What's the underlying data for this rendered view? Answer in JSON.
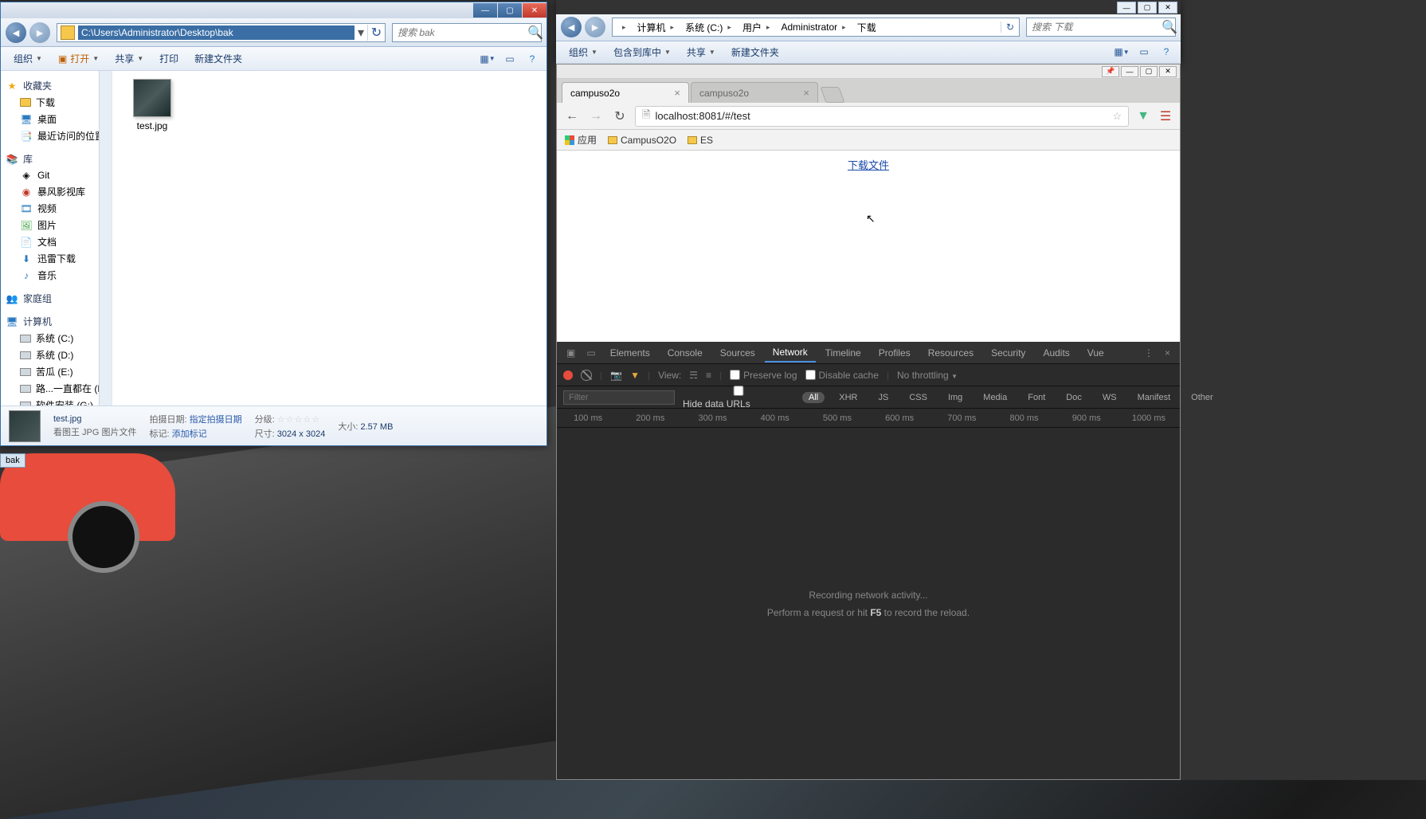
{
  "desktop": {
    "taskbar_item": "bak"
  },
  "explorer_left": {
    "titlebar": {
      "minimize": "—",
      "maximize": "▢",
      "close": "✕"
    },
    "address": "C:\\Users\\Administrator\\Desktop\\bak",
    "address_dropdown": "▾",
    "refresh": "↻",
    "search_placeholder": "搜索 bak",
    "toolbar": {
      "organize": "组织",
      "open": "打开",
      "share": "共享",
      "print": "打印",
      "new_folder": "新建文件夹"
    },
    "sidebar": {
      "favorites": {
        "label": "收藏夹",
        "items": [
          "下载",
          "桌面",
          "最近访问的位置"
        ]
      },
      "libraries": {
        "label": "库",
        "items": [
          "Git",
          "暴风影视库",
          "视频",
          "图片",
          "文档",
          "迅雷下载",
          "音乐"
        ]
      },
      "homegroup": {
        "label": "家庭组"
      },
      "computer": {
        "label": "计算机",
        "items": [
          "系统 (C:)",
          "系统 (D:)",
          "苦瓜 (E:)",
          "路...一直都在 (F:)",
          "软件安装 (G:)"
        ]
      }
    },
    "file": {
      "name": "test.jpg"
    },
    "details": {
      "filename": "test.jpg",
      "subtitle": "看图王 JPG 图片文件",
      "shot_date_label": "拍摄日期:",
      "shot_date_value": "指定拍摄日期",
      "tags_label": "标记:",
      "tags_value": "添加标记",
      "rating_label": "分级:",
      "dimensions_label": "尺寸:",
      "dimensions_value": "3024 x 3024",
      "size_label": "大小:",
      "size_value": "2.57 MB"
    }
  },
  "explorer_right": {
    "breadcrumb": [
      "计算机",
      "系统 (C:)",
      "用户",
      "Administrator",
      "下载"
    ],
    "refresh": "↻",
    "search_placeholder": "搜索 下载",
    "toolbar": {
      "organize": "组织",
      "include": "包含到库中",
      "share": "共享",
      "new_folder": "新建文件夹"
    },
    "winbtns": {
      "minimize": "—",
      "maximize": "▢",
      "close": "✕"
    }
  },
  "chrome": {
    "sysbtns": {
      "pin": "📌",
      "minimize": "—",
      "maximize": "▢",
      "close": "✕"
    },
    "tabs": [
      {
        "title": "campuso2o",
        "active": true
      },
      {
        "title": "campuso2o",
        "active": false
      }
    ],
    "nav": {
      "back": "←",
      "forward": "→",
      "reload": "↻"
    },
    "url": {
      "full": "localhost:8081/#/test"
    },
    "bookmarks_bar": {
      "apps": "应用",
      "items": [
        "CampusO2O",
        "ES"
      ]
    },
    "page": {
      "link_text": "下载文件"
    },
    "devtools": {
      "panels": [
        "Elements",
        "Console",
        "Sources",
        "Network",
        "Timeline",
        "Profiles",
        "Resources",
        "Security",
        "Audits",
        "Vue"
      ],
      "active_panel": "Network",
      "toolbar": {
        "view_label": "View:",
        "preserve_log": "Preserve log",
        "disable_cache": "Disable cache",
        "throttling": "No throttling"
      },
      "filter": {
        "placeholder": "Filter",
        "hide_data_urls": "Hide data URLs",
        "types": [
          "All",
          "XHR",
          "JS",
          "CSS",
          "Img",
          "Media",
          "Font",
          "Doc",
          "WS",
          "Manifest",
          "Other"
        ],
        "active_type": "All"
      },
      "timeline_ticks": [
        "100 ms",
        "200 ms",
        "300 ms",
        "400 ms",
        "500 ms",
        "600 ms",
        "700 ms",
        "800 ms",
        "900 ms",
        "1000 ms"
      ],
      "message_title": "Recording network activity...",
      "message_hint_pre": "Perform a request or hit ",
      "message_hint_key": "F5",
      "message_hint_post": " to record the reload."
    }
  }
}
